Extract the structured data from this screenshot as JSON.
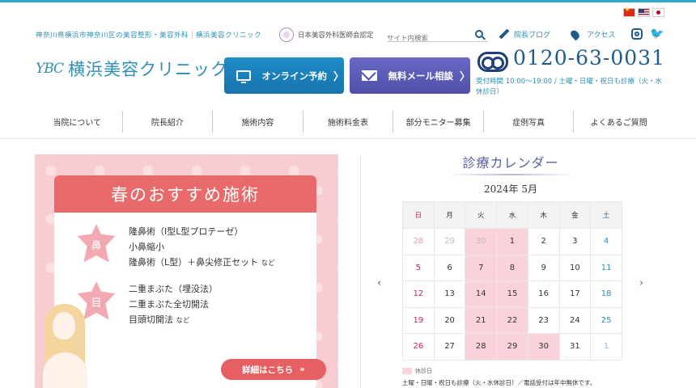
{
  "header": {
    "breadcrumb": "神奈川県横浜市神奈川区の美容整形・美容外科｜横浜美容クリニック",
    "association": "日本美容外科医師会認定",
    "search_placeholder": "サイト内検索",
    "blog_label": "院長ブログ",
    "access_label": "アクセス",
    "logo_mark": "YBC",
    "logo_text": "横浜美容クリニック",
    "online_label": "オンライン予約",
    "mail_label": "無料メール相談",
    "chevron": "〉",
    "phone": "0120-63-0031",
    "hours": "受付時間 10:00～19:00 / 土曜・日曜・祝日も診療（火・水休診日）"
  },
  "nav": [
    "当院について",
    "院長紹介",
    "施術内容",
    "施術料金表",
    "部分モニター募集",
    "症例写真",
    "よくあるご質問"
  ],
  "banner": {
    "title": "春のおすすめ施術",
    "nose_tag": "鼻",
    "nose_lines": [
      "隆鼻術（I型L型プロテーゼ）",
      "小鼻縮小",
      "隆鼻術（L型）＋鼻尖修正セット"
    ],
    "eye_tag": "目",
    "eye_lines": [
      "二重まぶた（埋没法）",
      "二重まぶた全切開法",
      "目頭切開法"
    ],
    "etc": "など",
    "detail_label": "詳細はこちら",
    "detail_chevron": "»"
  },
  "calendar": {
    "title": "診療カレンダー",
    "month": "2024年 5月",
    "weekdays": [
      "日",
      "月",
      "火",
      "水",
      "木",
      "金",
      "土"
    ],
    "weeks": [
      [
        "28",
        "29",
        "30",
        "1",
        "2",
        "3",
        "4"
      ],
      [
        "5",
        "6",
        "7",
        "8",
        "9",
        "10",
        "11"
      ],
      [
        "12",
        "13",
        "14",
        "15",
        "16",
        "17",
        "18"
      ],
      [
        "19",
        "20",
        "21",
        "22",
        "23",
        "24",
        "25"
      ],
      [
        "26",
        "27",
        "28",
        "29",
        "30",
        "31",
        "1"
      ]
    ],
    "closed_cells": [
      [
        0,
        2
      ],
      [
        0,
        3
      ],
      [
        1,
        2
      ],
      [
        1,
        3
      ],
      [
        2,
        2
      ],
      [
        2,
        3
      ],
      [
        3,
        2
      ],
      [
        3,
        3
      ],
      [
        4,
        2
      ],
      [
        4,
        3
      ],
      [
        4,
        4
      ]
    ],
    "out_of_month_cells": [
      [
        0,
        0
      ],
      [
        0,
        1
      ],
      [
        0,
        2
      ],
      [
        4,
        6
      ]
    ],
    "legend_label": "休診日",
    "note": "土曜・日曜・祝日も診療（火・水休診日）／電話受付は年中無休です。",
    "prev": "‹",
    "next": "›"
  },
  "colors": {
    "accent": "#2d8fb4",
    "online_btn": "#1e8dc8",
    "mail_btn": "#5d5db8",
    "banner_pink": "#f8cdd2",
    "banner_red": "#e96a6a",
    "closed": "#fad2da"
  }
}
